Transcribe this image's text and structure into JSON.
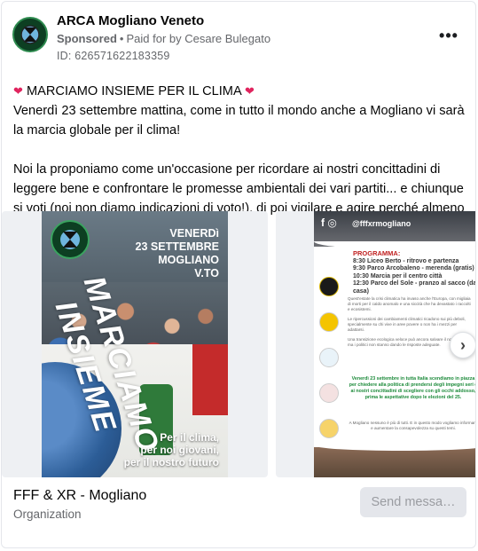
{
  "header": {
    "page_name": "ARCA Mogliano Veneto",
    "sponsored_label": "Sponsored",
    "paid_for_by": "Paid for by Cesare Bulegato",
    "ad_id": "ID: 626571622183359",
    "more_label": "•••"
  },
  "body": {
    "heart": "❤",
    "headline": "MARCIAMO INSIEME PER IL CLIMA",
    "line1": "Venerdì 23 settembre mattina, come in tutto il mondo anche a Mogliano vi sarà la marcia globale per il clima!",
    "line2": "Noi la proponiamo come un'occasione per ricordare ai nostri concittadini di leggere bene e confrontare le promesse ambientali dei vari partiti... e chiunque si voti (noi non diamo indicazioni di voto!), di poi vigilare e agire perché almeno tali…"
  },
  "slide1": {
    "date_lines": [
      "VENERDì",
      "23 SETTEMBRE",
      "MOGLIANO",
      "V.TO"
    ],
    "title_a": "MARCIAMO",
    "title_b": "INSIEME",
    "footer_lines": [
      "Per il clima,",
      "per noi giovani,",
      "per il nostro futuro"
    ]
  },
  "slide2": {
    "handle": "@fffxrmogliano",
    "program_title": "PROGRAMMA:",
    "program": [
      "8:30 Liceo Berto - ritrovo e partenza",
      "9:30 Parco Arcobaleno - merenda (gratis)",
      "10:30 Marcia per il centro città",
      "12:30 Parco del Sole - pranzo al sacco (da casa)"
    ],
    "para1": "Quest'estate la crisi climatica ha invaso anche l'Europa, con migliaia di morti per il caldo anomalo e una siccità che ha devastato i raccolti e ecosistemi.",
    "para2": "Le ripercussioni dei cambiamenti climatici ricadono sui più deboli, specialmente su chi vive in aree povere o non ha i mezzi per adattarsi.",
    "para3": "Una transizione ecologica veloce può ancora salvare il nostro futuro, ma i politici non stanno dando le risposte adeguate.",
    "green": "Venerdì 23 settembre in tutta Italia scendiamo in piazza per chiedere alla politica di prendersi degli impegni seri e ai nostri concittadini di scegliere con gli occhi addosso, prima le aspettative dopo le elezioni del 25.",
    "foot": "A Mogliano nessuno è più di tutti. E in questo modo vogliamo informare e aumentare la consapevolezza su questi temi."
  },
  "footer": {
    "title": "FFF & XR - Mogliano",
    "subtitle": "Organization",
    "send_label": "Send messa…"
  },
  "icons": {
    "next": "›"
  },
  "colors": {
    "heart": "#e0245e",
    "secondary_text": "#65676b",
    "button_bg": "#e4e6eb",
    "green_text": "#1c8a3a",
    "program_red": "#c02020"
  }
}
